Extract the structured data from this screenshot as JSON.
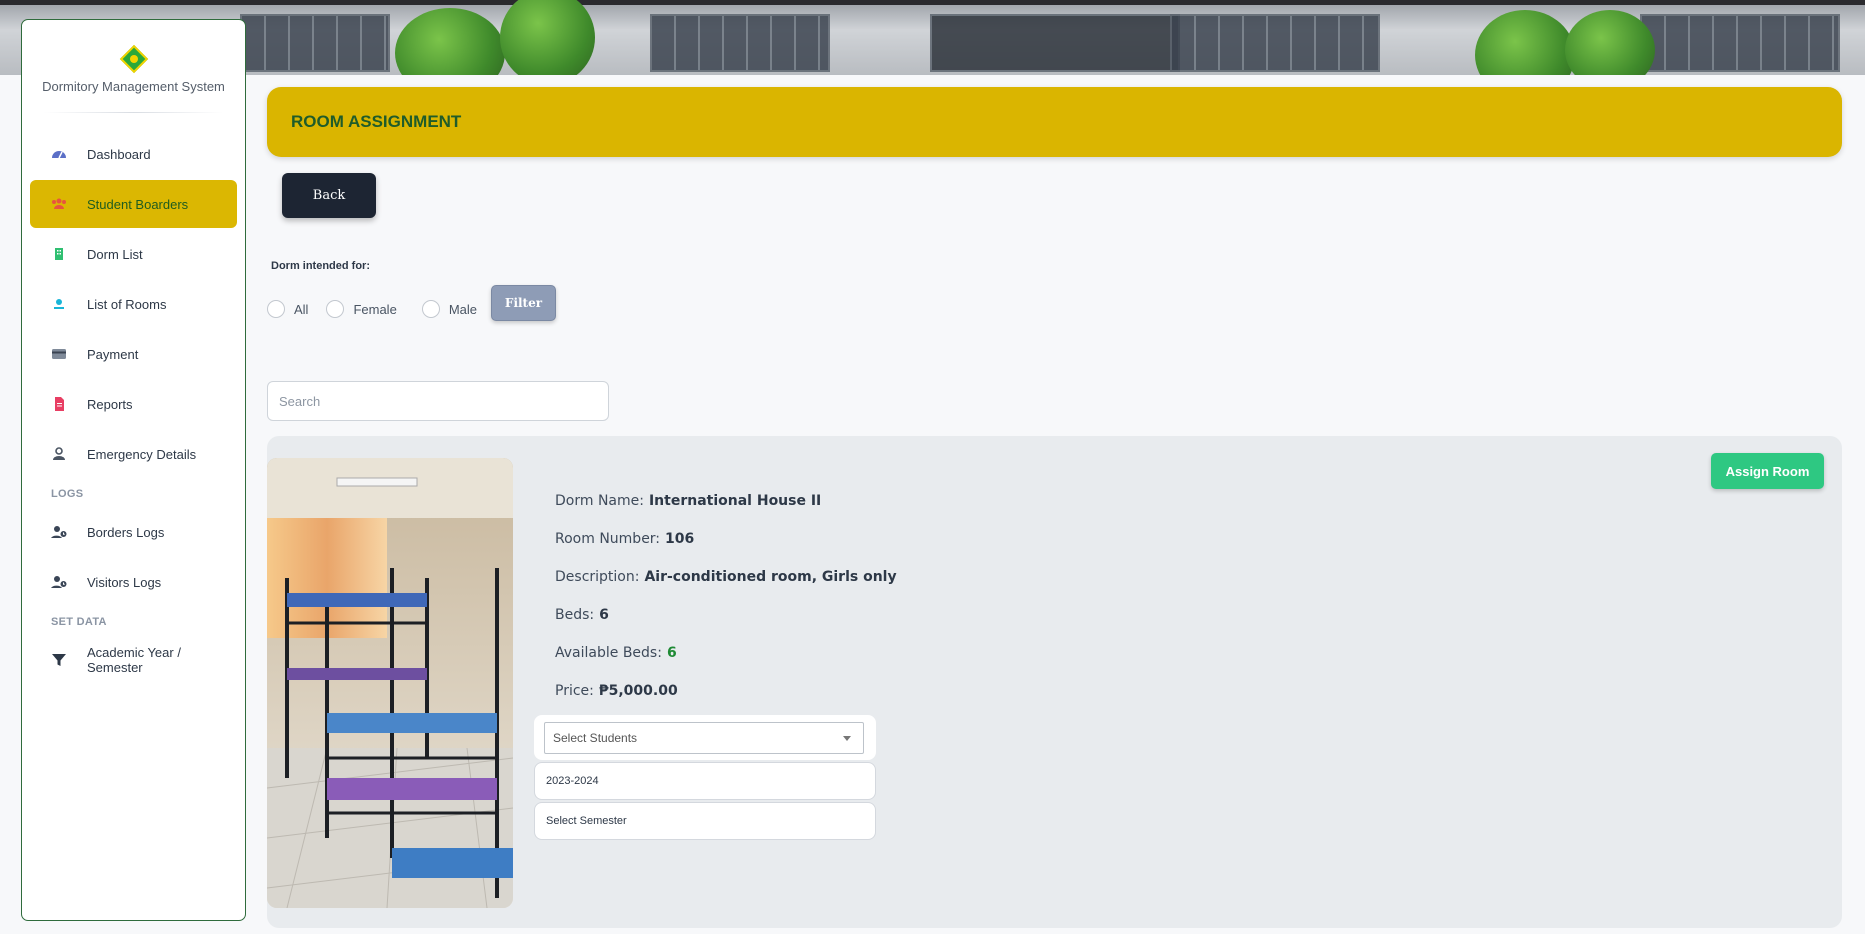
{
  "brand": {
    "name": "Dormitory Management System"
  },
  "sidebar": {
    "items": [
      {
        "label": "Dashboard",
        "icon": "dashboard-gauge-icon"
      },
      {
        "label": "Student Boarders",
        "icon": "users-icon",
        "active": true
      },
      {
        "label": "Dorm List",
        "icon": "building-icon"
      },
      {
        "label": "List of Rooms",
        "icon": "room-user-icon"
      },
      {
        "label": "Payment",
        "icon": "credit-card-icon"
      },
      {
        "label": "Reports",
        "icon": "document-icon"
      },
      {
        "label": "Emergency Details",
        "icon": "contact-badge-icon"
      }
    ],
    "logs_heading": "LOGS",
    "logs": [
      {
        "label": "Borders Logs",
        "icon": "user-clock-icon"
      },
      {
        "label": "Visitors Logs",
        "icon": "user-clock-icon"
      }
    ],
    "set_data_heading": "SET DATA",
    "set_data": [
      {
        "label": "Academic Year / Semester",
        "icon": "filter-funnel-icon"
      }
    ]
  },
  "header": {
    "title": "ROOM ASSIGNMENT"
  },
  "actions": {
    "back_label": "Back",
    "filter_label": "Filter"
  },
  "filter": {
    "label": "Dorm intended for:",
    "options": [
      "All",
      "Female",
      "Male"
    ]
  },
  "search": {
    "placeholder": "Search",
    "value": ""
  },
  "room": {
    "assign_label": "Assign Room",
    "dorm_name_label": "Dorm Name:",
    "dorm_name": "International House II",
    "room_number_label": "Room Number:",
    "room_number": "106",
    "description_label": "Description:",
    "description": "Air-conditioned room, Girls only",
    "beds_label": "Beds:",
    "beds": "6",
    "available_beds_label": "Available Beds:",
    "available_beds": "6",
    "price_label": "Price:",
    "price": "₱5,000.00",
    "select_students_placeholder": "Select Students",
    "academic_year": "2023-2024",
    "semester_placeholder": "Select Semester"
  },
  "colors": {
    "accent": "#dab500",
    "active_text": "#1f5c1f",
    "dark_button": "#1d2533",
    "assign_button": "#2ec882",
    "available_green": "#1e8a34"
  }
}
